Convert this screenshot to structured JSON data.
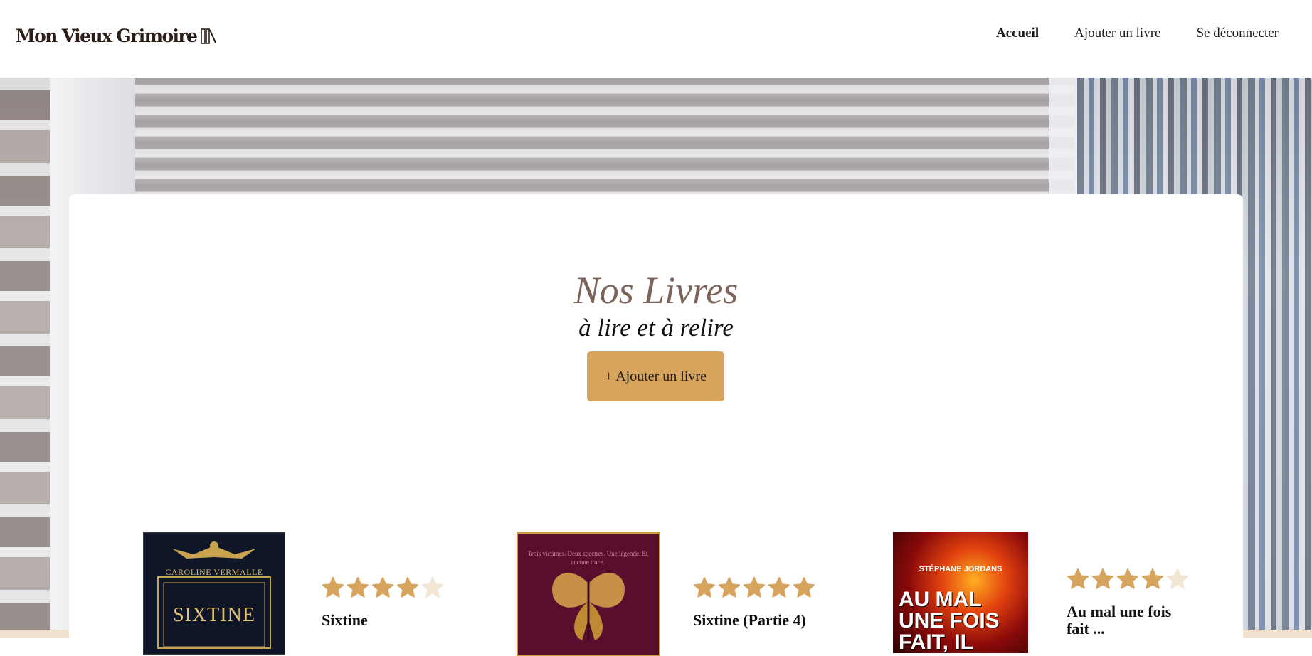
{
  "header": {
    "logo_text": "Mon Vieux Grimoire",
    "logo_icon": "books-icon",
    "nav": [
      {
        "label": "Accueil",
        "active": true
      },
      {
        "label": "Ajouter un livre",
        "active": false
      },
      {
        "label": "Se déconnecter",
        "active": false
      }
    ]
  },
  "hero": {
    "title": "Nos Livres",
    "subtitle": "à lire et à relire",
    "add_button": "+ Ajouter un livre"
  },
  "books": [
    {
      "title": "Sixtine",
      "rating": 4,
      "max_rating": 5,
      "cover_author": "CAROLINE VERMALLE",
      "cover_title": "SIXTINE"
    },
    {
      "title": "Sixtine (Partie 4)",
      "rating": 5,
      "max_rating": 5,
      "cover_tagline": "Trois victimes. Deux spectres. Une légende. Et aucune trace."
    },
    {
      "title": "Au mal une fois fait ...",
      "rating": 4,
      "max_rating": 5,
      "cover_author": "STÉPHANE JORDANS",
      "cover_title": "AU MAL UNE FOIS FAIT, IL N'EST PAS"
    }
  ],
  "colors": {
    "accent": "#d6a45d",
    "title": "#7d645a",
    "star_filled": "#d6a45d",
    "star_empty": "#f3e6d4"
  }
}
